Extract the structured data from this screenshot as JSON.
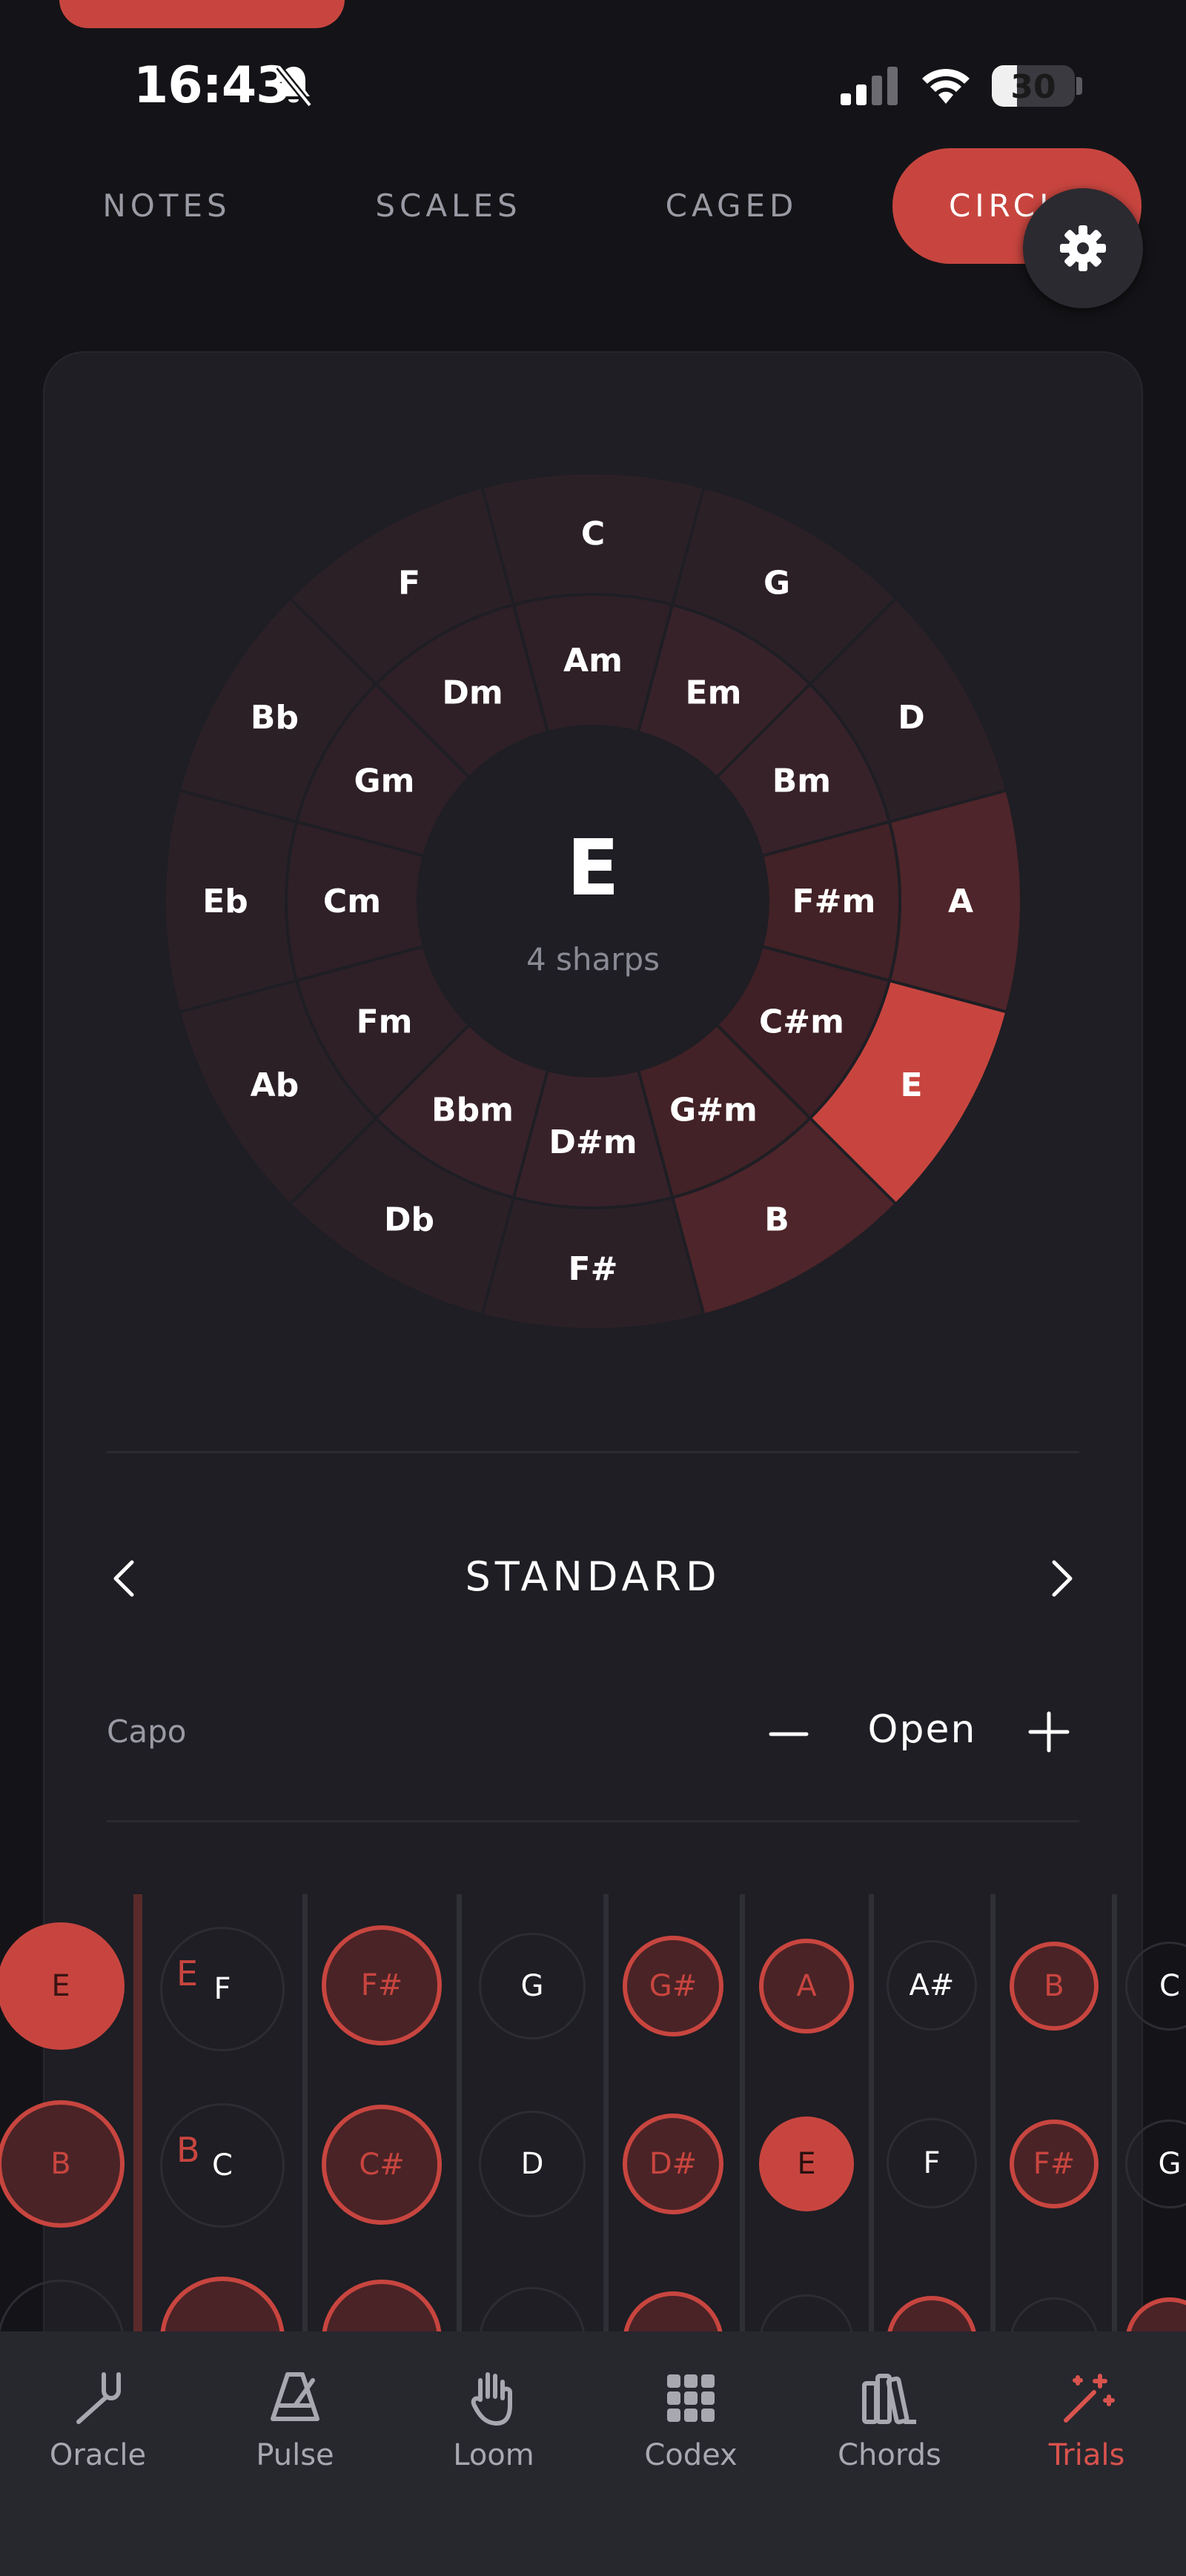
{
  "status": {
    "time": "16:43",
    "battery": "30",
    "battery_level": 0.3
  },
  "tabs": [
    {
      "label": "NOTES",
      "active": false
    },
    {
      "label": "SCALES",
      "active": false
    },
    {
      "label": "CAGED",
      "active": false
    },
    {
      "label": "CIRCLE",
      "active": true
    }
  ],
  "circle": {
    "major_keys": [
      "C",
      "G",
      "D",
      "A",
      "E",
      "B",
      "F#",
      "Db",
      "Ab",
      "Eb",
      "Bb",
      "F"
    ],
    "minor_keys": [
      "Am",
      "Em",
      "Bm",
      "F#m",
      "C#m",
      "G#m",
      "D#m",
      "Bbm",
      "Fm",
      "Cm",
      "Gm",
      "Dm"
    ],
    "selected_key": "E",
    "selected_subtitle": "4 sharps"
  },
  "tuning": {
    "label": "STANDARD"
  },
  "capo": {
    "label": "Capo",
    "value": "Open"
  },
  "fretboard": {
    "open_strings": [
      "E",
      "B"
    ],
    "rows": [
      {
        "open": "E",
        "notes": [
          "F",
          "F#",
          "G",
          "G#",
          "A",
          "A#",
          "B",
          "C"
        ]
      },
      {
        "open": "B",
        "notes": [
          "C",
          "C#",
          "D",
          "D#",
          "E",
          "F",
          "F#",
          "G"
        ]
      }
    ]
  },
  "nav": [
    {
      "label": "Oracle",
      "icon": "tuning-fork-icon",
      "active": false
    },
    {
      "label": "Pulse",
      "icon": "metronome-icon",
      "active": false
    },
    {
      "label": "Loom",
      "icon": "hand-icon",
      "active": false
    },
    {
      "label": "Codex",
      "icon": "grid-icon",
      "active": false
    },
    {
      "label": "Chords",
      "icon": "books-icon",
      "active": false
    },
    {
      "label": "Trials",
      "icon": "magic-wand-icon",
      "active": true
    }
  ],
  "colors": {
    "accent": "#c8453f",
    "background": "#141418",
    "panel": "#1e1e24"
  }
}
